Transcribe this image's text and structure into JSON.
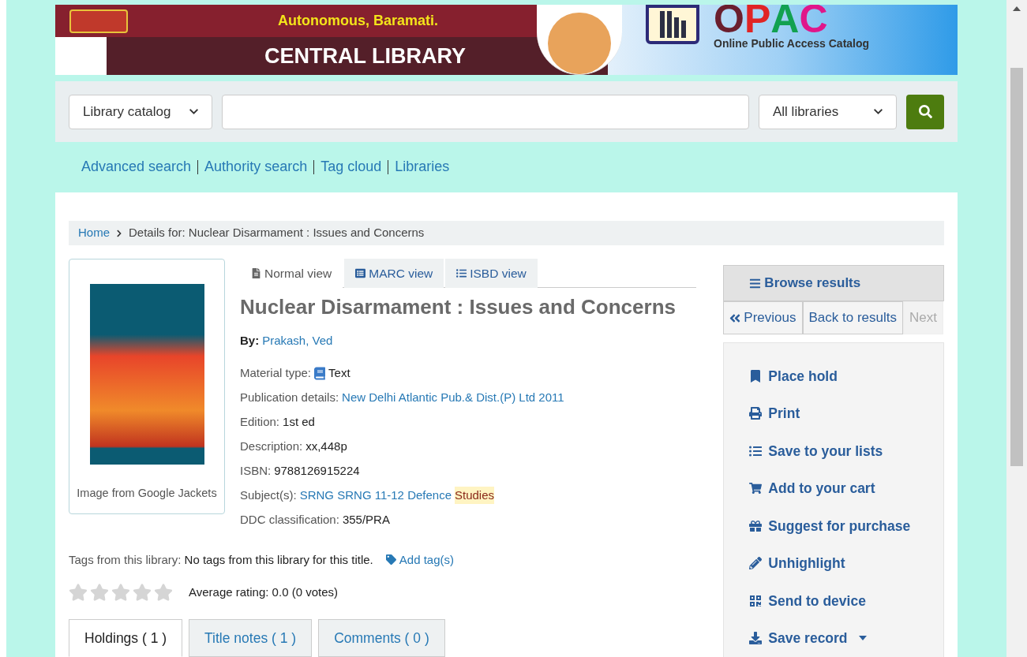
{
  "banner": {
    "subtitle": "Autonomous, Baramati.",
    "title": "CENTRAL LIBRARY",
    "opac": "OPAC",
    "opac_caption": "Online Public Access Catalog"
  },
  "search": {
    "scope": "Library catalog",
    "library": "All libraries"
  },
  "nav_links": [
    "Advanced search",
    "Authority search",
    "Tag cloud",
    "Libraries"
  ],
  "breadcrumb": [
    {
      "label": "Home",
      "kind": "link"
    },
    {
      "label": "Details for: Nuclear Disarmament : Issues and Concerns",
      "kind": "text"
    }
  ],
  "cover": {
    "caption": "Image from Google Jackets"
  },
  "view_tabs": [
    {
      "label": "Normal view",
      "selected": true
    },
    {
      "label": "MARC view",
      "selected": false
    },
    {
      "label": "ISBD view",
      "selected": false
    }
  ],
  "record": {
    "title": "Nuclear Disarmament : Issues and Concerns",
    "by_label": "By:",
    "author": "Prakash, Ved",
    "fields": [
      {
        "label": "Material type:",
        "value": "Text",
        "kind": "material"
      },
      {
        "label": "Publication details:",
        "value": "New Delhi Atlantic Pub.& Dist.(P) Ltd 2011",
        "kind": "link"
      },
      {
        "label": "Edition:",
        "value": "1st ed",
        "kind": "plain"
      },
      {
        "label": "Description:",
        "value": "xx,448p",
        "kind": "plain"
      },
      {
        "label": "ISBN:",
        "value": "9788126915224",
        "kind": "plain"
      },
      {
        "label": "Subject(s):",
        "value": "SRNG SRNG 11-12 Defence",
        "highlight": "Studies",
        "kind": "subject"
      },
      {
        "label": "DDC classification:",
        "value": "355/PRA",
        "kind": "plain"
      }
    ]
  },
  "tags": {
    "label": "Tags from this library:",
    "value": "No tags from this library for this title.",
    "action": "Add tag(s)"
  },
  "rating": {
    "stars": 0,
    "text": "Average rating: 0.0 (0 votes)"
  },
  "bottom_tabs": [
    {
      "label": "Holdings ( 1 )",
      "selected": true
    },
    {
      "label": "Title notes ( 1 )",
      "selected": false
    },
    {
      "label": "Comments ( 0 )",
      "selected": false
    }
  ],
  "sidebar": {
    "browse": "Browse results",
    "pager": [
      {
        "label": "Previous",
        "kind": "prev",
        "disabled": false
      },
      {
        "label": "Back to results",
        "kind": "back",
        "disabled": false
      },
      {
        "label": "Next",
        "kind": "next",
        "disabled": true
      }
    ],
    "actions": [
      {
        "label": "Place hold",
        "kind": "hold"
      },
      {
        "label": "Print",
        "kind": "print"
      },
      {
        "label": "Save to your lists",
        "kind": "lists"
      },
      {
        "label": "Add to your cart",
        "kind": "cart"
      },
      {
        "label": "Suggest for purchase",
        "kind": "suggest"
      },
      {
        "label": "Unhighlight",
        "kind": "unhighlight"
      },
      {
        "label": "Send to device",
        "kind": "device"
      },
      {
        "label": "Save record",
        "kind": "save",
        "dropdown": true
      }
    ]
  }
}
